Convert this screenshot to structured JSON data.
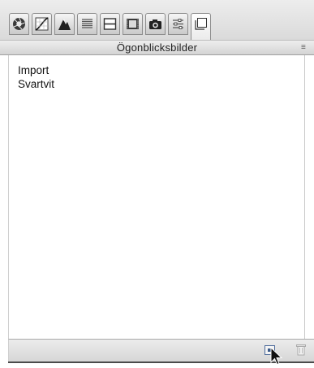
{
  "toolbar": {
    "tabs": [
      {
        "icon": "aperture-icon"
      },
      {
        "icon": "tone-curve-icon"
      },
      {
        "icon": "mountain-icon"
      },
      {
        "icon": "lines-icon"
      },
      {
        "icon": "split-panel-icon"
      },
      {
        "icon": "film-icon"
      },
      {
        "icon": "camera-icon"
      },
      {
        "icon": "sliders-icon"
      },
      {
        "icon": "snapshot-icon",
        "active": true
      }
    ]
  },
  "panel": {
    "title": "Ögonblicksbilder",
    "menu_glyph": "≡"
  },
  "snapshots": [
    {
      "label": "Import"
    },
    {
      "label": "Svartvit"
    }
  ],
  "colors": {
    "accent": "#3a5a8a"
  }
}
